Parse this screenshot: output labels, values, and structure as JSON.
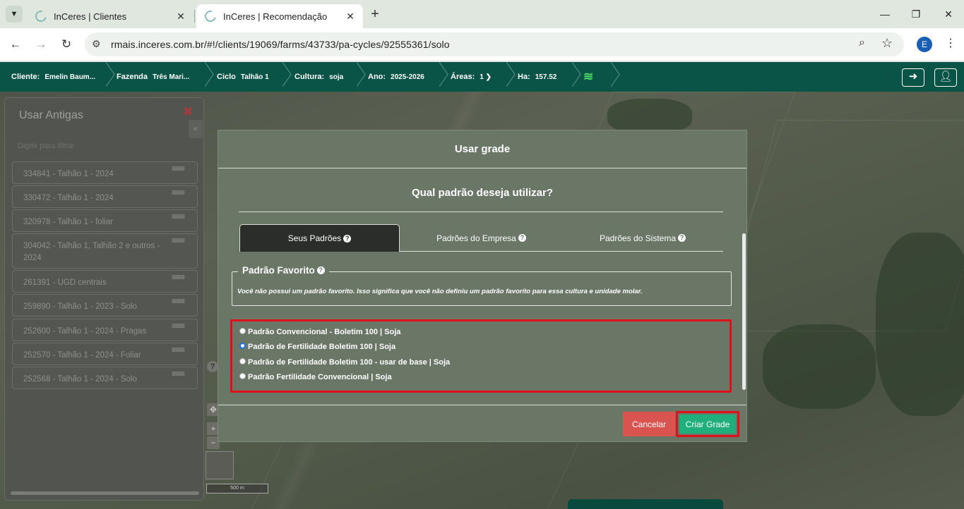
{
  "browser": {
    "tabs": [
      {
        "title": "InCeres | Clientes",
        "active": false
      },
      {
        "title": "InCeres | Recomendação",
        "active": true
      }
    ],
    "tab_menu_icon": "chevron-down-icon",
    "new_tab_label": "+",
    "window_controls": {
      "minimize": "—",
      "restore": "❐",
      "close": "✕"
    },
    "url": "rmais.inceres.com.br/#!/clients/19069/farms/43733/pa-cycles/92555361/solo",
    "profile_initial": "E"
  },
  "appbar": {
    "crumbs": [
      {
        "label": "Cliente:",
        "value": "Emelin Baum..."
      },
      {
        "label": "Fazenda",
        "value": "Três Mari..."
      },
      {
        "label": "Ciclo",
        "value": "Talhão 1"
      },
      {
        "label": "Cultura:",
        "value": "soja"
      },
      {
        "label": "Ano:",
        "value": "2025-2026"
      },
      {
        "label": "Áreas:",
        "value": "1 ❯"
      },
      {
        "label": "Ha:",
        "value": "157.52"
      }
    ],
    "back_icon": "arrow-left-icon",
    "user_icon": "user-icon"
  },
  "left_panel": {
    "title": "Usar Antigas",
    "close_label": "✖",
    "collapse_label": "«",
    "filter_placeholder": "Digite para filtrar",
    "items": [
      "334841 - Talhão 1 - 2024",
      "330472 - Talhão 1 - 2024",
      "320978 - Talhão 1 - foliar",
      "304042 - Talhão 1, Talhão 2 e outros - 2024",
      "261391 - UGD centrais",
      "259890 - Talhão 1 - 2023 - Solo",
      "252600 - Talhão 1 - 2024 - Pragas",
      "252570 - Talhão 1 - 2024 - Foliar",
      "252568 - Talhão 1 - 2024 - Solo"
    ],
    "item_menu": "≡≡≡"
  },
  "map": {
    "zoom_in": "+",
    "zoom_out": "−",
    "move_icon": "✥",
    "help_label": "?",
    "scale": "500 m"
  },
  "modal": {
    "title": "Usar grade",
    "question": "Qual padrão deseja utilizar?",
    "tabs": [
      {
        "label": "Seus Padrões",
        "active": true
      },
      {
        "label": "Padrões do Empresa",
        "active": false
      },
      {
        "label": "Padrões do Sistema",
        "active": false
      }
    ],
    "favorite": {
      "legend": "Padrão Favorito",
      "text": "Você não possui um padrão favorito. Isso significa que você não definiu um padrão favorito para essa cultura e unidade molar."
    },
    "options": [
      {
        "label": "Padrão Convencional - Boletim 100 | Soja",
        "checked": false
      },
      {
        "label": "Padrão de Fertilidade Boletim 100 | Soja",
        "checked": true
      },
      {
        "label": "Padrão de Fertilidade Boletim 100 - usar de base | Soja",
        "checked": false
      },
      {
        "label": "Padrão Fertilidade Convencional | Soja",
        "checked": false
      }
    ],
    "cancel_label": "Cancelar",
    "create_label": "Criar Grade"
  }
}
